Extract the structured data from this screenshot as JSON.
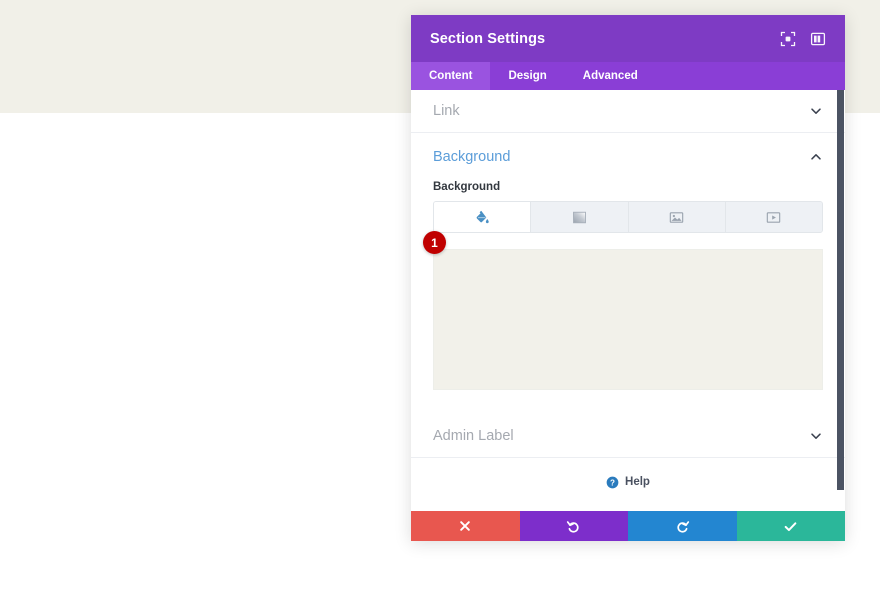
{
  "window": {
    "title": "Section Settings",
    "header_icons": [
      {
        "name": "expand-icon",
        "label": "Expand"
      },
      {
        "name": "panel-layout-icon",
        "label": "Change panel layout"
      }
    ]
  },
  "tabs": [
    {
      "label": "Content",
      "active": true
    },
    {
      "label": "Design",
      "active": false
    },
    {
      "label": "Advanced",
      "active": false
    }
  ],
  "sections": {
    "link": {
      "title": "Link",
      "open": false
    },
    "background": {
      "title": "Background",
      "open": true,
      "field_label": "Background",
      "types": [
        {
          "name": "background-color",
          "icon": "paint-bucket-icon",
          "active": true
        },
        {
          "name": "background-gradient",
          "icon": "gradient-icon",
          "active": false
        },
        {
          "name": "background-image",
          "icon": "image-icon",
          "active": false
        },
        {
          "name": "background-video",
          "icon": "video-icon",
          "active": false
        }
      ],
      "preview_color": "#f2f1ea"
    },
    "admin_label": {
      "title": "Admin Label",
      "open": false
    }
  },
  "help": {
    "label": "Help",
    "icon": "question-mark-icon"
  },
  "callouts": [
    {
      "number": "1"
    }
  ],
  "footer": {
    "buttons": [
      {
        "name": "cancel-button",
        "icon": "x-icon",
        "color": "#e8574f"
      },
      {
        "name": "undo-button",
        "icon": "undo-icon",
        "color": "#7d2ecb"
      },
      {
        "name": "redo-button",
        "icon": "redo-icon",
        "color": "#2386d1"
      },
      {
        "name": "save-button",
        "icon": "check-icon",
        "color": "#2bb79a"
      }
    ]
  },
  "colors": {
    "header_purple": "#7e3bc4",
    "tabbar_purple": "#8a3ed6",
    "active_tab_purple": "#9a53e0",
    "accent_blue": "#5b9dd9",
    "page_band": "#f1f0e8",
    "badge_red": "#c00000"
  }
}
